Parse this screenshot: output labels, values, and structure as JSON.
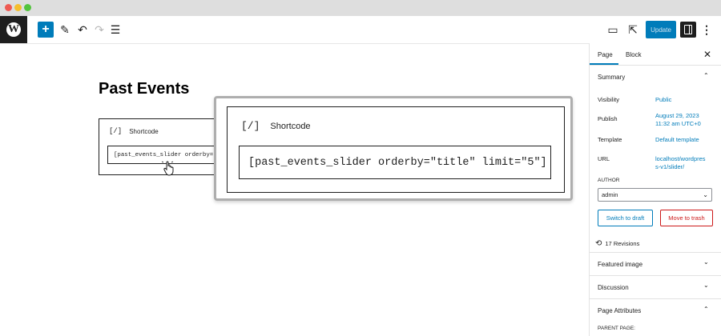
{
  "toolbar": {
    "wp_logo_glyph": "W",
    "add_glyph": "+",
    "pen_glyph": "✎",
    "undo_glyph": "↶",
    "redo_glyph": "↷",
    "list_glyph": "☰",
    "view_glyph": "▭",
    "external_glyph": "⇱",
    "update_label": "Update",
    "more_glyph": "⋮",
    "icons": [
      "wordpress-logo",
      "add-block",
      "edit-pen",
      "undo",
      "redo",
      "list-view",
      "preview",
      "external-link",
      "settings-panel",
      "more-options"
    ]
  },
  "editor": {
    "title": "Past Events",
    "block": {
      "icon_glyph": "[/]",
      "label": "Shortcode",
      "value": "[past_events_slider orderby=\"ti"
    }
  },
  "zoom": {
    "icon_glyph": "[/]",
    "label": "Shortcode",
    "value": "[past_events_slider orderby=\"title\" limit=\"5\"]"
  },
  "sidebar": {
    "tabs": [
      "Page",
      "Block"
    ],
    "close_glyph": "✕",
    "summary_title": "Summary",
    "visibility_label": "Visibility",
    "visibility_value": "Public",
    "publish_label": "Publish",
    "publish_value_line1": "August 29, 2023",
    "publish_value_line2": "11:32 am UTC+0",
    "template_label": "Template",
    "template_value": "Default template",
    "url_label": "URL",
    "url_line1": "localhost/wordpres",
    "url_line2": "s-v1/slider/",
    "author_label": "AUTHOR",
    "author_value": "admin",
    "switch_draft_label": "Switch to draft",
    "trash_label": "Move to trash",
    "revisions_label": "17 Revisions",
    "featured_image_title": "Featured image",
    "discussion_title": "Discussion",
    "page_attributes_title": "Page Attributes",
    "parent_page_label": "PARENT PAGE:",
    "chevron_up": "⌃",
    "chevron_down": "⌄",
    "clock_glyph": "⟲"
  },
  "colors": {
    "accent": "#007cba",
    "danger": "#cc1818",
    "dark": "#1e1e1e"
  }
}
